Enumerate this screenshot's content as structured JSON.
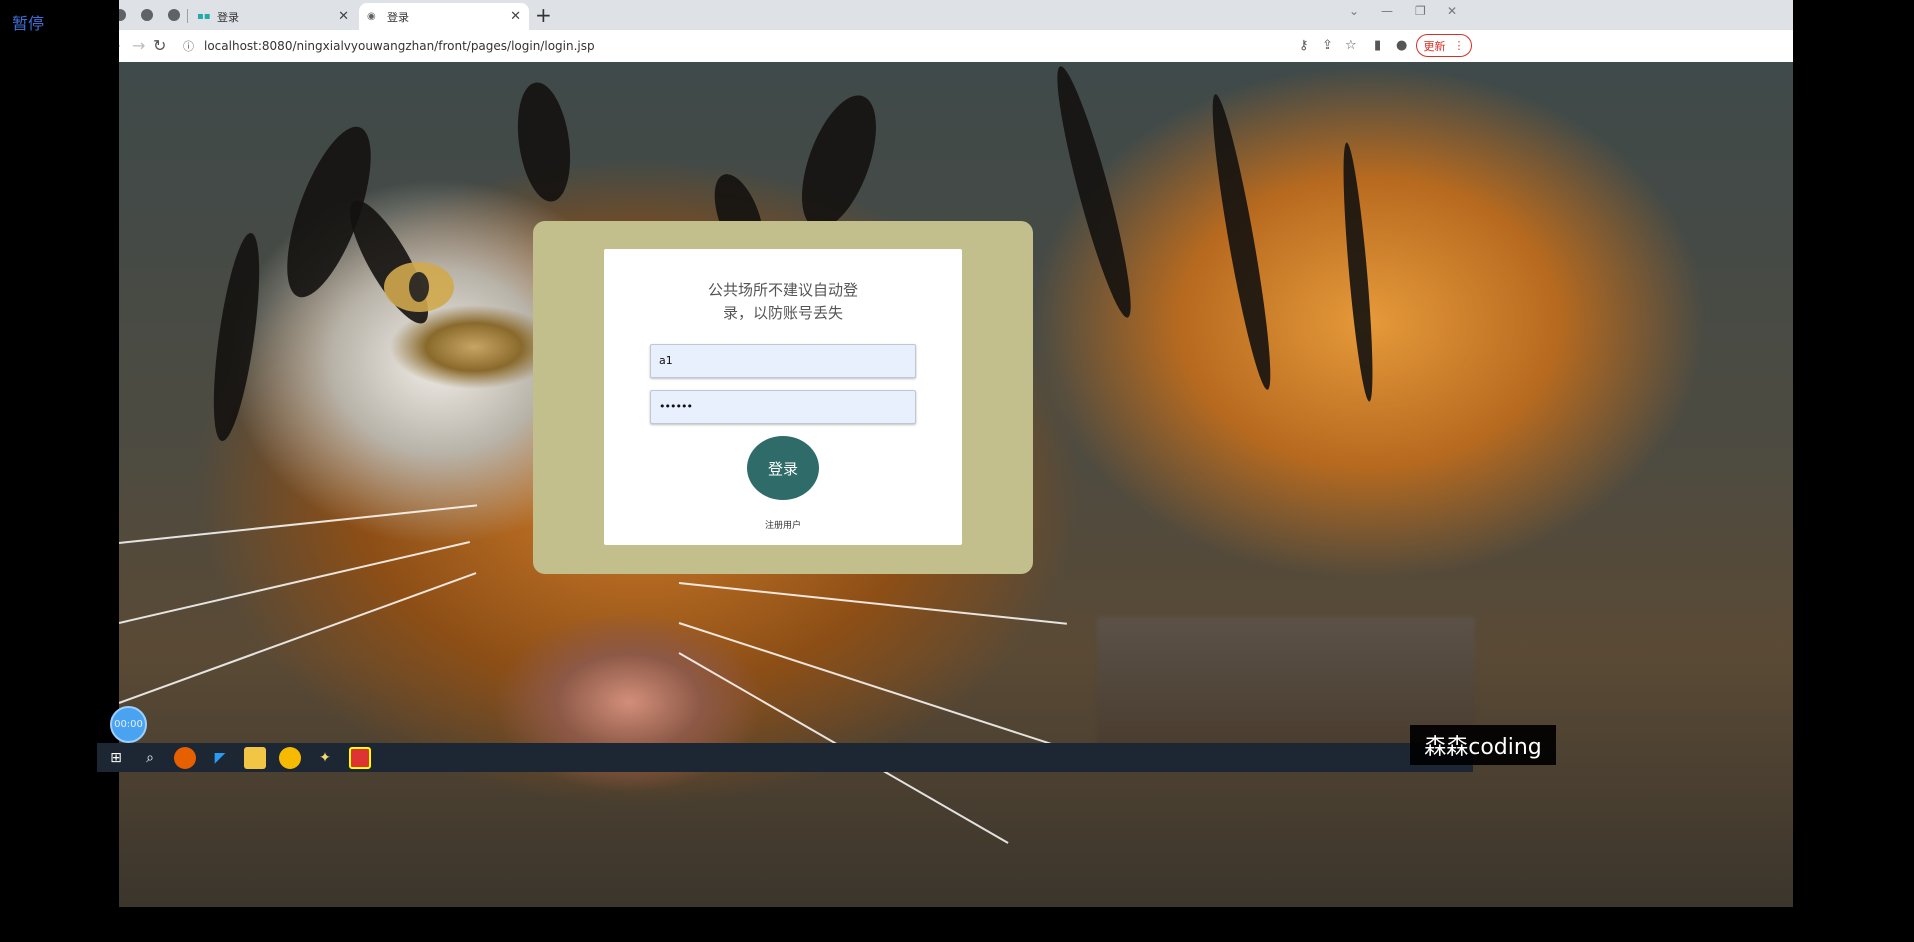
{
  "overlay": {
    "pause_label": "暂停",
    "timer": "00:00",
    "watermark": "森森coding"
  },
  "browser": {
    "tabs": [
      {
        "title": "登录",
        "active": false,
        "favicon": "leaf-icon"
      },
      {
        "title": "登录",
        "active": true,
        "favicon": "globe-icon"
      }
    ],
    "url": "localhost:8080/ningxialvyouwangzhan/front/pages/login/login.jsp",
    "update_label": "更新"
  },
  "login": {
    "notice_line1": "公共场所不建议自动登",
    "notice_line2": "录，以防账号丢失",
    "username_value": "a1",
    "password_value": "••••••",
    "submit_label": "登录",
    "register_label": "注册用户"
  },
  "colors": {
    "panel": "#c2bf8c",
    "button": "#2f6b69",
    "input_bg": "#e8f0fe",
    "update": "#d93025"
  }
}
